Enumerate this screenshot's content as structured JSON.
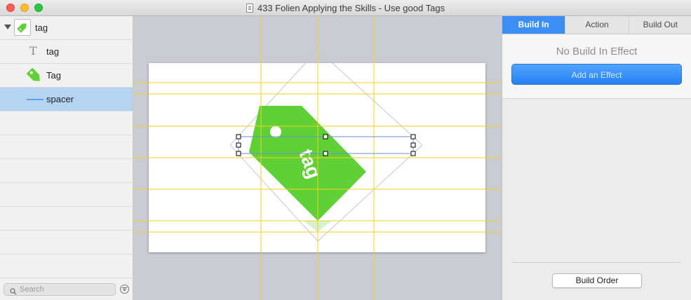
{
  "window": {
    "title": "433 Folien Applying the Skills - Use good Tags"
  },
  "sidebar": {
    "group": {
      "label": "tag",
      "expanded": true
    },
    "items": [
      {
        "label": "tag",
        "icon": "text-icon"
      },
      {
        "label": "Tag",
        "icon": "tag-shape-icon"
      },
      {
        "label": "spacer",
        "icon": "line-icon",
        "selected": true
      }
    ],
    "search": {
      "placeholder": "Search"
    }
  },
  "canvas": {
    "slide_text": "tag",
    "guide_color": "#f2d21b",
    "tag_color": "#5fd136"
  },
  "inspector": {
    "tabs": [
      {
        "label": "Build In",
        "active": true
      },
      {
        "label": "Action"
      },
      {
        "label": "Build Out"
      }
    ],
    "empty_message": "No Build In Effect",
    "add_effect_label": "Add an Effect",
    "build_order_label": "Build Order",
    "accent": "#3b8ef3"
  }
}
